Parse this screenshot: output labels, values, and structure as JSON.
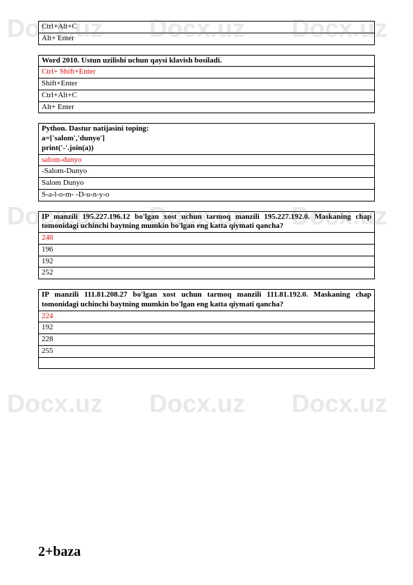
{
  "watermark": "Docx.uz",
  "blocks": [
    {
      "type": "partial",
      "rows": [
        {
          "text": "Ctrl+Alt+C",
          "kind": "answer"
        },
        {
          "text": "Alt+ Enter",
          "kind": "answer"
        }
      ]
    },
    {
      "type": "full",
      "question": "Word 2010. Ustun uzilishi uchun qaysi klavish bosiladi.",
      "justify": false,
      "answers": [
        {
          "text": "Ctrl+ Shift+Enter",
          "correct": true
        },
        {
          "text": "Shift+Enter",
          "correct": false
        },
        {
          "text": "Ctrl+Alt+C",
          "correct": false
        },
        {
          "text": "Alt+ Enter",
          "correct": false
        }
      ]
    },
    {
      "type": "full",
      "question": "Python. Dastur natijasini toping:\na=['salom','dunyo']\nprint('-'.join(a))",
      "justify": false,
      "answers": [
        {
          "text": "salom-dunyo",
          "correct": true
        },
        {
          "text": "-Salom-Dunyo",
          "correct": false
        },
        {
          "text": "Salom Dunyo",
          "correct": false
        },
        {
          "text": "S-a-l-o-m- -D-u-n-y-o",
          "correct": false
        }
      ]
    },
    {
      "type": "full",
      "question": "IP manzili 195.227.196.12 bo'lgan xost uchun tarmoq manzili 195.227.192.0. Maskaning chap tomonidagi uchinchi baytning mumkin bo'lgan eng katta qiymati qancha?",
      "justify": true,
      "answers": [
        {
          "text": "248",
          "correct": true
        },
        {
          "text": "196",
          "correct": false
        },
        {
          "text": "192",
          "correct": false
        },
        {
          "text": "252",
          "correct": false
        }
      ]
    },
    {
      "type": "full-trailing",
      "question": "IP manzili 111.81.208.27 bo'lgan xost uchun tarmoq manzili 111.81.192.0. Maskaning chap tomonidagi uchinchi baytning mumkin bo'lgan eng katta qiymati qancha?",
      "justify": true,
      "answers": [
        {
          "text": "224",
          "correct": true
        },
        {
          "text": "192",
          "correct": false
        },
        {
          "text": "228",
          "correct": false
        },
        {
          "text": "255",
          "correct": false
        }
      ]
    }
  ],
  "footer": "2+baza"
}
